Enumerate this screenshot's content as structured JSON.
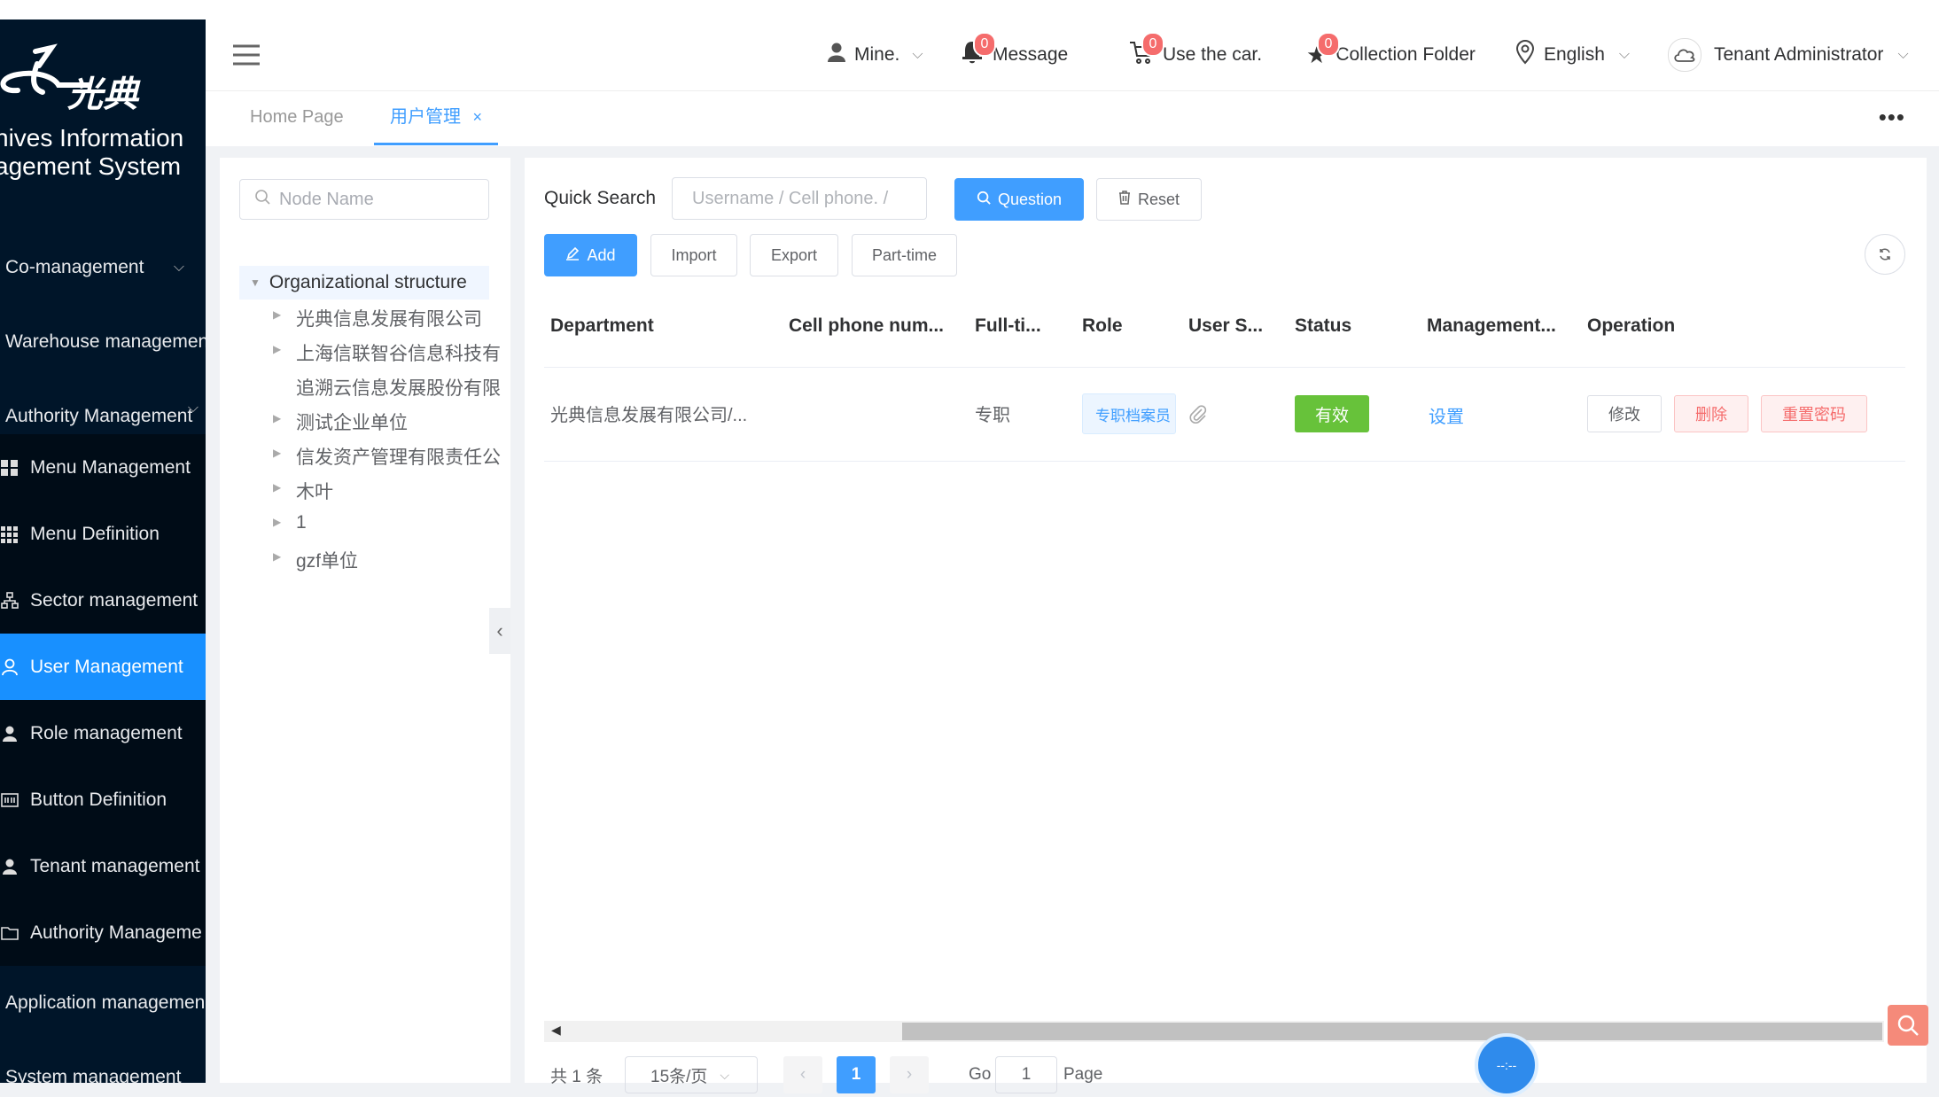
{
  "app": {
    "logo_text": "光典",
    "system_title_line1": "hives Information",
    "system_title_line2": "agement System"
  },
  "sidebar": {
    "items": [
      {
        "label": "Co-management",
        "icon": "chevron-down-icon"
      },
      {
        "label": "Warehouse managemen",
        "icon": ""
      },
      {
        "label": "Authority Management",
        "icon": ""
      },
      {
        "label": "Menu Management",
        "icon": "grid-icon"
      },
      {
        "label": "Menu Definition",
        "icon": "grid-9-icon"
      },
      {
        "label": "Sector management",
        "icon": "org-chart-icon"
      },
      {
        "label": "User Management",
        "icon": "user-icon"
      },
      {
        "label": "Role management",
        "icon": "user-filled-icon"
      },
      {
        "label": "Button Definition",
        "icon": "button-icon"
      },
      {
        "label": "Tenant management",
        "icon": "tenant-icon"
      },
      {
        "label": "Authority Manageme",
        "icon": "folder-icon"
      },
      {
        "label": "Application managemen",
        "icon": ""
      },
      {
        "label": "System management",
        "icon": ""
      }
    ]
  },
  "header": {
    "mine": "Mine.",
    "message": "Message",
    "message_count": "0",
    "cart": "Use the car.",
    "cart_count": "0",
    "collection": "Collection Folder",
    "collection_count": "0",
    "language": "English",
    "user": "Tenant Administrator"
  },
  "tabs": {
    "home": "Home Page",
    "current": "用户管理",
    "close": "×"
  },
  "tree": {
    "search_placeholder": "Node Name",
    "root": "Organizational structure",
    "nodes": [
      "光典信息发展有限公司",
      "上海信联智谷信息科技有",
      "追溯云信息发展股份有限",
      "测试企业单位",
      "信发资产管理有限责任公",
      "木叶",
      "1",
      "gzf单位"
    ]
  },
  "toolbar": {
    "quick_search_label": "Quick Search",
    "search_placeholder": "Username  / Cell phone.  /",
    "question": "Question",
    "reset": "Reset",
    "add": "Add",
    "import": "Import",
    "export": "Export",
    "parttime": "Part-time"
  },
  "table": {
    "headers": [
      "Department",
      "Cell phone num...",
      "Full-ti...",
      "Role",
      "User S...",
      "Status",
      "Management...",
      "Operation"
    ],
    "rows": [
      {
        "department": "光典信息发展有限公司/...",
        "phone": "",
        "fulltime": "专职",
        "role": "专职档案员",
        "status": "有效",
        "management": "设置",
        "op_edit": "修改",
        "op_delete": "删除",
        "op_reset": "重置密码"
      }
    ]
  },
  "pagination": {
    "total": "共 1 条",
    "page_size": "15条/页",
    "current_page": "1",
    "go_label": "Go",
    "go_value": "1",
    "page_label": "Page"
  },
  "colors": {
    "primary": "#409eff",
    "sidebar_bg": "#001529",
    "active": "#1890ff",
    "success": "#67c23a",
    "danger": "#f56c6c"
  }
}
